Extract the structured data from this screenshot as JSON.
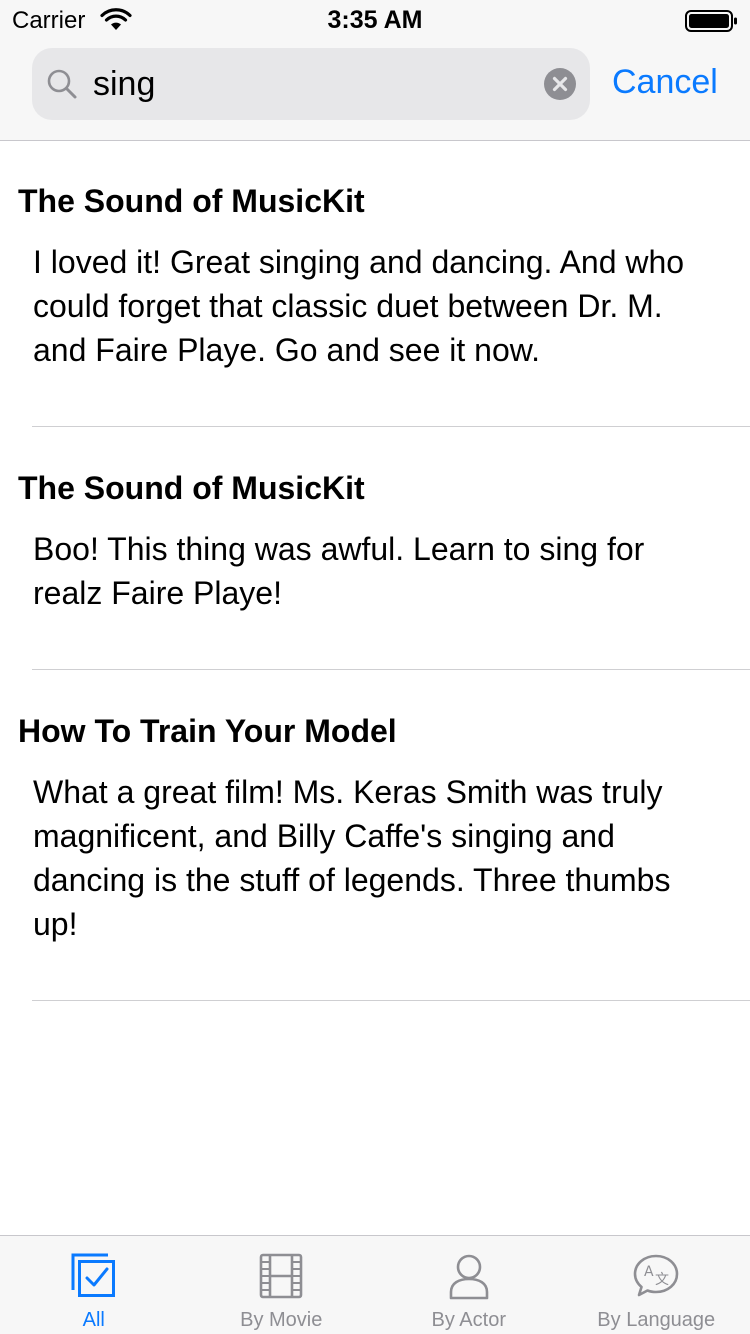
{
  "status_bar": {
    "carrier": "Carrier",
    "time": "3:35 AM"
  },
  "search": {
    "query": "sing",
    "cancel_label": "Cancel"
  },
  "results": [
    {
      "title": "The Sound of MusicKit",
      "body": "I loved it! Great singing and dancing. And who could forget that classic duet between Dr. M. and Faire Playe. Go and see it now."
    },
    {
      "title": "The Sound of MusicKit",
      "body": "Boo! This thing was awful. Learn to sing for realz Faire Playe!"
    },
    {
      "title": "How To Train Your Model",
      "body": "What a great film! Ms. Keras Smith was truly magnificent, and Billy Caffe's singing and dancing is the stuff of legends. Three thumbs up!"
    }
  ],
  "tab_bar": {
    "tabs": [
      {
        "label": "All",
        "icon": "checkbox-stack-icon",
        "selected": true
      },
      {
        "label": "By Movie",
        "icon": "film-icon",
        "selected": false
      },
      {
        "label": "By Actor",
        "icon": "person-icon",
        "selected": false
      },
      {
        "label": "By Language",
        "icon": "translate-bubble-icon",
        "selected": false
      }
    ]
  },
  "colors": {
    "accent": "#0a7aff",
    "inactive": "#8e8e93"
  }
}
